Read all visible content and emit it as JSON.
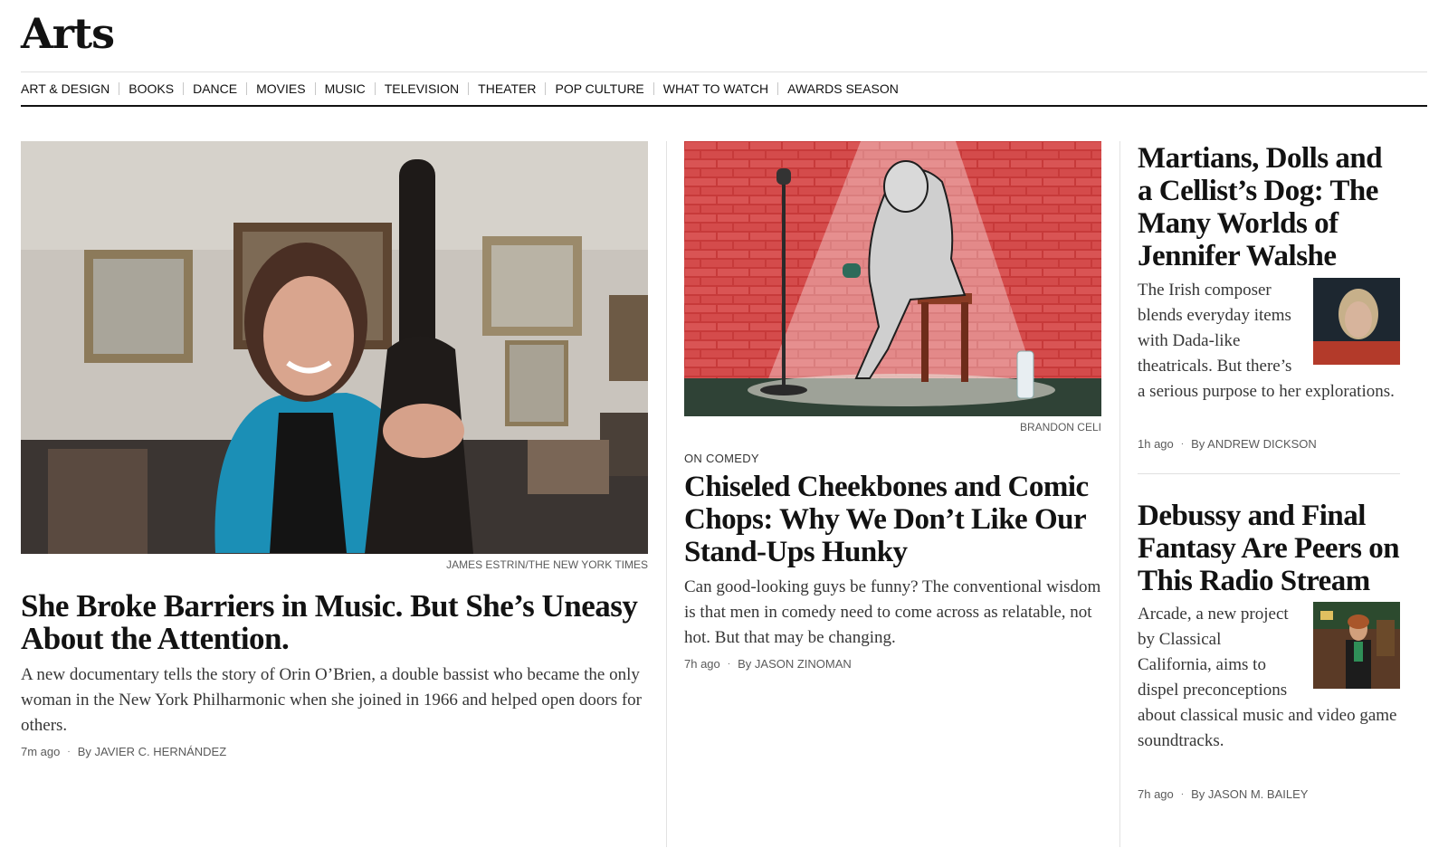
{
  "section_title": "Arts",
  "nav": {
    "items": [
      "ART & DESIGN",
      "BOOKS",
      "DANCE",
      "MOVIES",
      "MUSIC",
      "TELEVISION",
      "THEATER",
      "POP CULTURE",
      "WHAT TO WATCH",
      "AWARDS SEASON"
    ]
  },
  "lead": {
    "credit": "JAMES ESTRIN/THE NEW YORK TIMES",
    "headline": "She Broke Barriers in Music. But She’s Uneasy About the Attention.",
    "summary": "A new documentary tells the story of Orin O’Brien, a double bassist who became the only woman in the New York Philharmonic when she joined in 1966 and helped open doors for others.",
    "time": "7m ago",
    "byline": "By JAVIER C. HERNÁNDEZ"
  },
  "middle": {
    "credit": "BRANDON CELI",
    "kicker": "ON COMEDY",
    "headline": "Chiseled Cheekbones and Comic Chops: Why We Don’t Like Our Stand-Ups Hunky",
    "summary": "Can good-looking guys be funny? The conventional wisdom is that men in comedy need to come across as relatable, not hot. But that may be changing.",
    "time": "7h ago",
    "byline": "By JASON ZINOMAN"
  },
  "right_top": {
    "headline": "Martians, Dolls and a Cellist’s Dog: The Many Worlds of Jennifer Walshe",
    "summary": "The Irish composer blends everyday items with Dada-like theatricals. But there’s a serious purpose to her explorations.",
    "time": "1h ago",
    "byline": "By ANDREW DICKSON"
  },
  "right_bottom": {
    "headline": "Debussy and Final Fantasy Are Peers on This Radio Stream",
    "summary": "Arcade, a new project by Classical California, aims to dispel preconceptions about classical music and video game soundtracks.",
    "time": "7h ago",
    "byline": "By JASON M. BAILEY"
  },
  "icons": {
    "bullet": "·"
  }
}
